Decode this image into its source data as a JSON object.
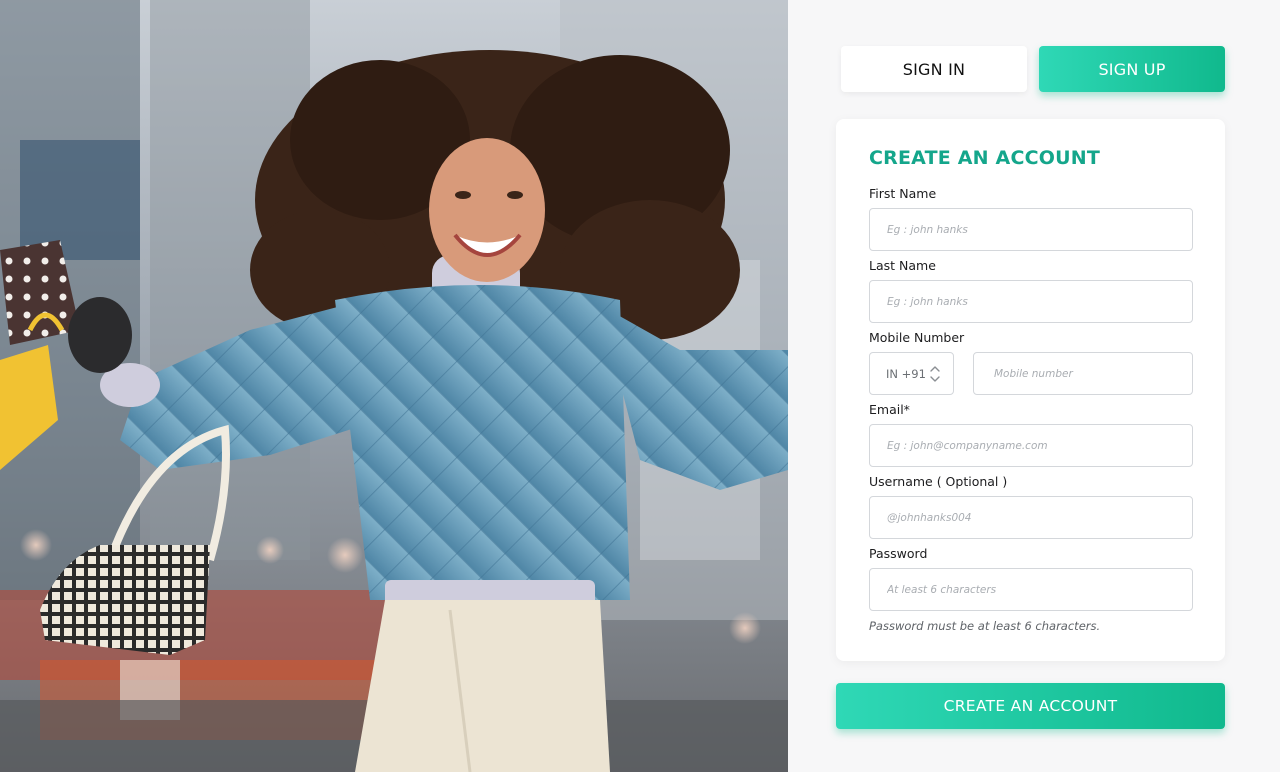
{
  "hero": {
    "image": "woman-jumping-with-shopping-bags-photo"
  },
  "tabs": {
    "sign_in": "SIGN IN",
    "sign_up": "SIGN UP",
    "active": "sign_up"
  },
  "form": {
    "title": "CREATE AN ACCOUNT",
    "first_name": {
      "label": "First Name",
      "placeholder": "Eg : john hanks",
      "value": ""
    },
    "last_name": {
      "label": "Last Name",
      "placeholder": "Eg : john hanks",
      "value": ""
    },
    "mobile": {
      "label": "Mobile Number",
      "country_code": "IN +91",
      "placeholder": "Mobile number",
      "value": ""
    },
    "email": {
      "label": "Email*",
      "placeholder": "Eg : john@companyname.com",
      "value": ""
    },
    "username": {
      "label": "Username ( Optional )",
      "placeholder": "@johnhanks004",
      "value": ""
    },
    "password": {
      "label": "Password",
      "placeholder": "At least 6 characters",
      "value": "",
      "hint": "Password must be at least 6 characters."
    },
    "submit_label": "CREATE AN ACCOUNT"
  },
  "colors": {
    "accent": "#14a68b",
    "accent_gradient_start": "#2fd8b6",
    "accent_gradient_end": "#10b98d",
    "panel_bg": "#f7f7f8",
    "card_bg": "#ffffff",
    "input_border": "#d4d7db"
  },
  "icons": {
    "country_stepper": "chevron-up-down-icon"
  }
}
